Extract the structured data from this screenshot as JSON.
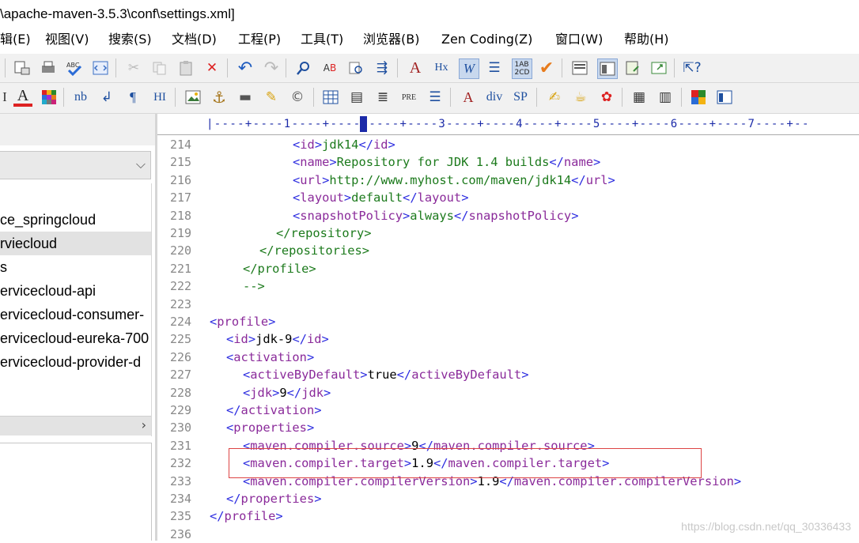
{
  "window": {
    "title": "\\apache-maven-3.5.3\\conf\\settings.xml]"
  },
  "menu": [
    {
      "label": "辑(E)"
    },
    {
      "label": "视图(V)"
    },
    {
      "label": "搜索(S)"
    },
    {
      "label": "文档(D)"
    },
    {
      "label": "工程(P)"
    },
    {
      "label": "工具(T)"
    },
    {
      "label": "浏览器(B)"
    },
    {
      "label": "Zen Coding(Z)"
    },
    {
      "label": "窗口(W)"
    },
    {
      "label": "帮助(H)"
    }
  ],
  "toolbar2_text": {
    "nb": "nb",
    "para": "¶",
    "hi": "HI",
    "pre": "PRE",
    "div": "div",
    "sp": "SP",
    "hx": "Hx"
  },
  "project": {
    "items": [
      {
        "label": "ce_springcloud"
      },
      {
        "label": "rviecloud"
      },
      {
        "label": "s"
      },
      {
        "label": "ervicecloud-api"
      },
      {
        "label": "ervicecloud-consumer-"
      },
      {
        "label": "ervicecloud-eureka-700"
      },
      {
        "label": "ervicecloud-provider-d"
      }
    ]
  },
  "ruler": {
    "text": "|----+----1----+----2----+----3----+----4----+----5----+----6----+----7----+--"
  },
  "editor": {
    "lines": [
      {
        "n": "214",
        "indent": 5,
        "tokens": [
          [
            "<",
            "tg"
          ],
          [
            "id",
            "pn"
          ],
          [
            ">",
            "tg"
          ],
          [
            "jdk14",
            "nm"
          ],
          [
            "</",
            "tg"
          ],
          [
            "id",
            "pn"
          ],
          [
            ">",
            "tg"
          ]
        ]
      },
      {
        "n": "215",
        "indent": 5,
        "tokens": [
          [
            "<",
            "tg"
          ],
          [
            "name",
            "pn"
          ],
          [
            ">",
            "tg"
          ],
          [
            "Repository for JDK 1.4 builds",
            "nm"
          ],
          [
            "</",
            "tg"
          ],
          [
            "name",
            "pn"
          ],
          [
            ">",
            "tg"
          ]
        ]
      },
      {
        "n": "216",
        "indent": 5,
        "tokens": [
          [
            "<",
            "tg"
          ],
          [
            "url",
            "pn"
          ],
          [
            ">",
            "tg"
          ],
          [
            "http://www.myhost.com/maven/jdk14",
            "nm"
          ],
          [
            "</",
            "tg"
          ],
          [
            "url",
            "pn"
          ],
          [
            ">",
            "tg"
          ]
        ]
      },
      {
        "n": "217",
        "indent": 5,
        "tokens": [
          [
            "<",
            "tg"
          ],
          [
            "layout",
            "pn"
          ],
          [
            ">",
            "tg"
          ],
          [
            "default",
            "nm"
          ],
          [
            "</",
            "tg"
          ],
          [
            "layout",
            "pn"
          ],
          [
            ">",
            "tg"
          ]
        ]
      },
      {
        "n": "218",
        "indent": 5,
        "tokens": [
          [
            "<",
            "tg"
          ],
          [
            "snapshotPolicy",
            "pn"
          ],
          [
            ">",
            "tg"
          ],
          [
            "always",
            "nm"
          ],
          [
            "</",
            "tg"
          ],
          [
            "snapshotPolicy",
            "pn"
          ],
          [
            ">",
            "tg"
          ]
        ]
      },
      {
        "n": "219",
        "indent": 4,
        "tokens": [
          [
            "</",
            "nm"
          ],
          [
            "repository",
            "nm"
          ],
          [
            ">",
            "nm"
          ]
        ]
      },
      {
        "n": "220",
        "indent": 3,
        "tokens": [
          [
            "</",
            "nm"
          ],
          [
            "repositories",
            "nm"
          ],
          [
            ">",
            "nm"
          ]
        ]
      },
      {
        "n": "221",
        "indent": 2,
        "tokens": [
          [
            "</",
            "nm"
          ],
          [
            "profile",
            "nm"
          ],
          [
            ">",
            "nm"
          ]
        ]
      },
      {
        "n": "222",
        "indent": 2,
        "tokens": [
          [
            "-->",
            "nm"
          ]
        ]
      },
      {
        "n": "223",
        "indent": 0,
        "tokens": []
      },
      {
        "n": "224",
        "indent": 0,
        "tokens": [
          [
            "<",
            "tg"
          ],
          [
            "profile",
            "pn"
          ],
          [
            ">",
            "tg"
          ]
        ]
      },
      {
        "n": "225",
        "indent": 1,
        "tokens": [
          [
            "<",
            "tg"
          ],
          [
            "id",
            "pn"
          ],
          [
            ">",
            "tg"
          ],
          [
            "jdk-9",
            "tx"
          ],
          [
            "</",
            "tg"
          ],
          [
            "id",
            "pn"
          ],
          [
            ">",
            "tg"
          ]
        ]
      },
      {
        "n": "226",
        "indent": 1,
        "tokens": [
          [
            "<",
            "tg"
          ],
          [
            "activation",
            "pn"
          ],
          [
            ">",
            "tg"
          ]
        ]
      },
      {
        "n": "227",
        "indent": 2,
        "tokens": [
          [
            "<",
            "tg"
          ],
          [
            "activeByDefault",
            "pn"
          ],
          [
            ">",
            "tg"
          ],
          [
            "true",
            "tx"
          ],
          [
            "</",
            "tg"
          ],
          [
            "activeByDefault",
            "pn"
          ],
          [
            ">",
            "tg"
          ]
        ]
      },
      {
        "n": "228",
        "indent": 2,
        "tokens": [
          [
            "<",
            "tg"
          ],
          [
            "jdk",
            "pn"
          ],
          [
            ">",
            "tg"
          ],
          [
            "9",
            "tx"
          ],
          [
            "</",
            "tg"
          ],
          [
            "jdk",
            "pn"
          ],
          [
            ">",
            "tg"
          ]
        ]
      },
      {
        "n": "229",
        "indent": 1,
        "tokens": [
          [
            "</",
            "tg"
          ],
          [
            "activation",
            "pn"
          ],
          [
            ">",
            "tg"
          ]
        ]
      },
      {
        "n": "230",
        "indent": 1,
        "tokens": [
          [
            "<",
            "tg"
          ],
          [
            "properties",
            "pn"
          ],
          [
            ">",
            "tg"
          ]
        ]
      },
      {
        "n": "231",
        "indent": 2,
        "tokens": [
          [
            "<",
            "tg"
          ],
          [
            "maven.compiler.source",
            "pn"
          ],
          [
            ">",
            "tg"
          ],
          [
            "9",
            "tx"
          ],
          [
            "</",
            "tg"
          ],
          [
            "maven.compiler.source",
            "pn"
          ],
          [
            ">",
            "tg"
          ]
        ]
      },
      {
        "n": "232",
        "indent": 2,
        "tokens": [
          [
            "<",
            "tg"
          ],
          [
            "maven.compiler.target",
            "pn"
          ],
          [
            ">",
            "tg"
          ],
          [
            "1.9",
            "tx"
          ],
          [
            "</",
            "tg"
          ],
          [
            "maven.compiler.target",
            "pn"
          ],
          [
            ">",
            "tg"
          ]
        ]
      },
      {
        "n": "233",
        "indent": 2,
        "tokens": [
          [
            "<",
            "tg"
          ],
          [
            "maven.compiler.compilerVersion",
            "pn"
          ],
          [
            ">",
            "tg"
          ],
          [
            "1.9",
            "tx"
          ],
          [
            "</",
            "tg"
          ],
          [
            "maven.compiler.compilerVersion",
            "pn"
          ],
          [
            ">",
            "tg"
          ]
        ]
      },
      {
        "n": "234",
        "indent": 1,
        "tokens": [
          [
            "</",
            "tg"
          ],
          [
            "properties",
            "pn"
          ],
          [
            ">",
            "tg"
          ]
        ]
      },
      {
        "n": "235",
        "indent": 0,
        "tokens": [
          [
            "</",
            "tg"
          ],
          [
            "profile",
            "pn"
          ],
          [
            ">",
            "tg"
          ]
        ]
      },
      {
        "n": "236",
        "indent": 0,
        "tokens": []
      }
    ]
  },
  "watermark": "https://blog.csdn.net/qq_30336433"
}
